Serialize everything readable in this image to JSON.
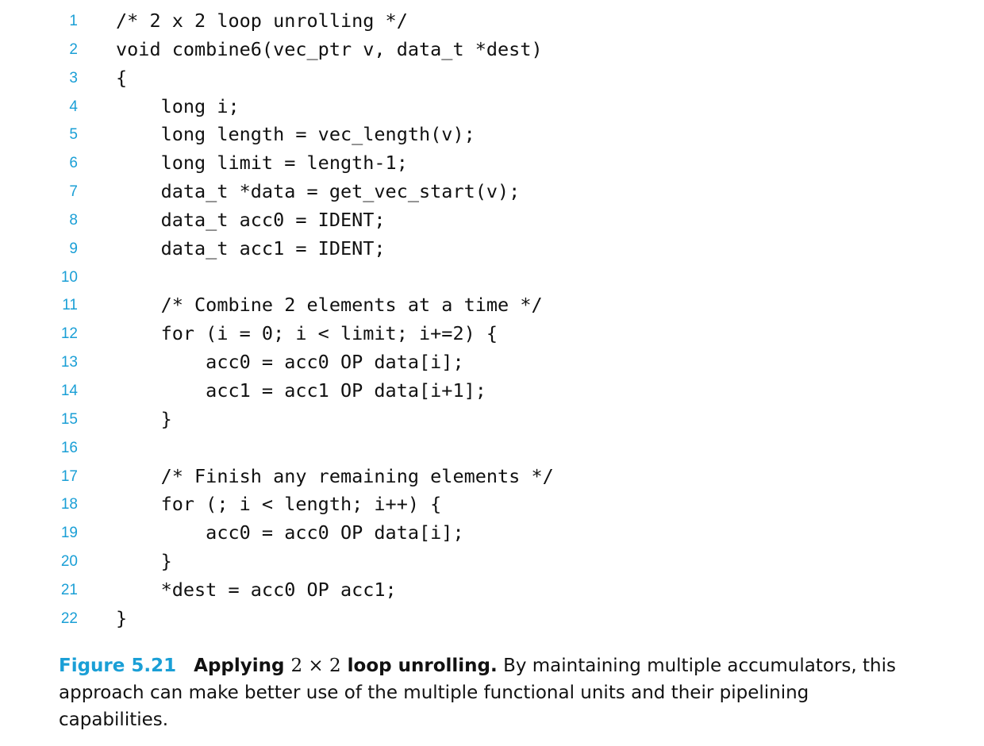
{
  "code": {
    "lines": [
      {
        "n": "1",
        "text": "/* 2 x 2 loop unrolling */"
      },
      {
        "n": "2",
        "text": "void combine6(vec_ptr v, data_t *dest)"
      },
      {
        "n": "3",
        "text": "{"
      },
      {
        "n": "4",
        "text": "    long i;"
      },
      {
        "n": "5",
        "text": "    long length = vec_length(v);"
      },
      {
        "n": "6",
        "text": "    long limit = length-1;"
      },
      {
        "n": "7",
        "text": "    data_t *data = get_vec_start(v);"
      },
      {
        "n": "8",
        "text": "    data_t acc0 = IDENT;"
      },
      {
        "n": "9",
        "text": "    data_t acc1 = IDENT;"
      },
      {
        "n": "10",
        "text": ""
      },
      {
        "n": "11",
        "text": "    /* Combine 2 elements at a time */"
      },
      {
        "n": "12",
        "text": "    for (i = 0; i < limit; i+=2) {"
      },
      {
        "n": "13",
        "text": "        acc0 = acc0 OP data[i];"
      },
      {
        "n": "14",
        "text": "        acc1 = acc1 OP data[i+1];"
      },
      {
        "n": "15",
        "text": "    }"
      },
      {
        "n": "16",
        "text": ""
      },
      {
        "n": "17",
        "text": "    /* Finish any remaining elements */"
      },
      {
        "n": "18",
        "text": "    for (; i < length; i++) {"
      },
      {
        "n": "19",
        "text": "        acc0 = acc0 OP data[i];"
      },
      {
        "n": "20",
        "text": "    }"
      },
      {
        "n": "21",
        "text": "    *dest = acc0 OP acc1;"
      },
      {
        "n": "22",
        "text": "}"
      }
    ]
  },
  "caption": {
    "label": "Figure 5.21",
    "title_pre": "Applying",
    "title_math": "2 × 2",
    "title_post": "loop unrolling.",
    "body": "By maintaining multiple accumulators, this approach can make better use of the multiple functional units and their pipelining capabilities."
  },
  "colors": {
    "accent": "#1a9fd6",
    "text": "#111111"
  }
}
